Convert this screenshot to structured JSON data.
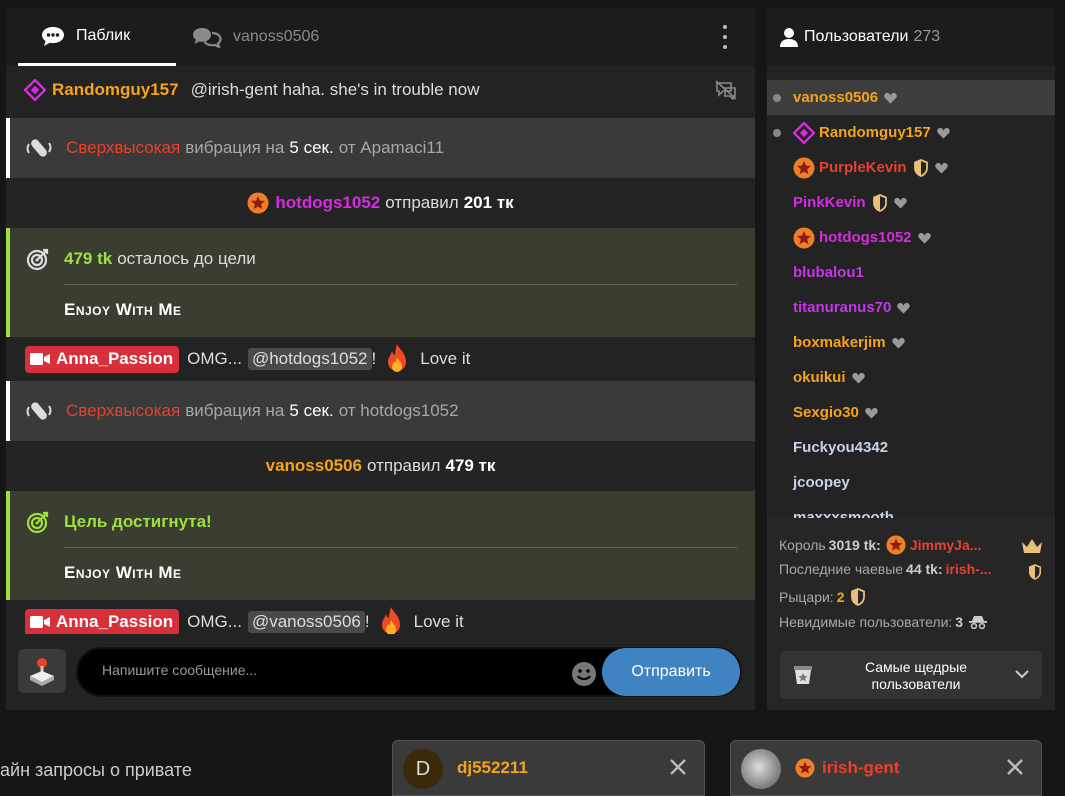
{
  "tabs": {
    "public_label": "Паблик",
    "private_label": "vanoss0506"
  },
  "messages": {
    "m1": {
      "user": "Randomguy157",
      "text": "@irish-gent  haha. she's in trouble now"
    },
    "m2": {
      "level": "Сверхвысокая",
      "text1": "вибрация на",
      "duration": "5 сек.",
      "from": "от Apamaci11"
    },
    "m3": {
      "user": "hotdogs1052",
      "text": "отправил",
      "amount": "201 тк"
    },
    "m4": {
      "amount": "479 tk",
      "text": "осталось до цели",
      "goal": "Enjoy With Me"
    },
    "m5": {
      "host": "Anna_Passion",
      "text": "OMG...",
      "mention": "@hotdogs1052",
      "excl": "!",
      "text2": "Love it"
    },
    "m6": {
      "level": "Сверхвысокая",
      "text1": "вибрация на",
      "duration": "5 сек.",
      "from": "от hotdogs1052"
    },
    "m7": {
      "user": "vanoss0506",
      "text": "отправил",
      "amount": "479 тк"
    },
    "m8": {
      "title": "Цель достигнута!",
      "goal": "Enjoy With Me"
    },
    "m9": {
      "host": "Anna_Passion",
      "text": "OMG...",
      "mention": "@vanoss0506",
      "excl": "!",
      "text2": "Love it"
    }
  },
  "input": {
    "placeholder": "Напишите сообщение...",
    "send_label": "Отправить"
  },
  "users_panel": {
    "title": "Пользователи",
    "count": "273",
    "users": [
      {
        "name": "vanoss0506",
        "color": "#f5a31a"
      },
      {
        "name": "Randomguy157",
        "color": "#f5a31a"
      },
      {
        "name": "PurpleKevin",
        "color": "#e8412c"
      },
      {
        "name": "PinkKevin",
        "color": "#d62ce0"
      },
      {
        "name": "hotdogs1052",
        "color": "#d62ce0"
      },
      {
        "name": "blubalou1",
        "color": "#c436e6"
      },
      {
        "name": "titanuranus70",
        "color": "#c436e6"
      },
      {
        "name": "boxmakerjim",
        "color": "#f5a31a"
      },
      {
        "name": "okuikui",
        "color": "#f5a31a"
      },
      {
        "name": "Sexgio30",
        "color": "#f5a31a"
      },
      {
        "name": "Fuckyou4342",
        "color": "#c8d4ea"
      },
      {
        "name": "jcoopey",
        "color": "#c8d4ea"
      },
      {
        "name": "maxxxsmooth",
        "color": "#c8d4ea"
      }
    ]
  },
  "stats": {
    "king_label": "Король",
    "king_amount": "3019 tk:",
    "king_user": "JimmyJa...",
    "last_tip_label": "Последние чаевые",
    "last_tip_amount": "44 tk:",
    "last_tip_user": "irish-...",
    "knights_label": "Рыцари:",
    "knights_count": "2",
    "invisible_label": "Невидимые пользователи:",
    "invisible_count": "3",
    "generous_label": "Самые щедрые пользователи"
  },
  "bottom": {
    "private_text": "айн запросы о привате",
    "popup1_initial": "D",
    "popup1_user": "dj552211",
    "popup2_user": "irish-gent"
  }
}
